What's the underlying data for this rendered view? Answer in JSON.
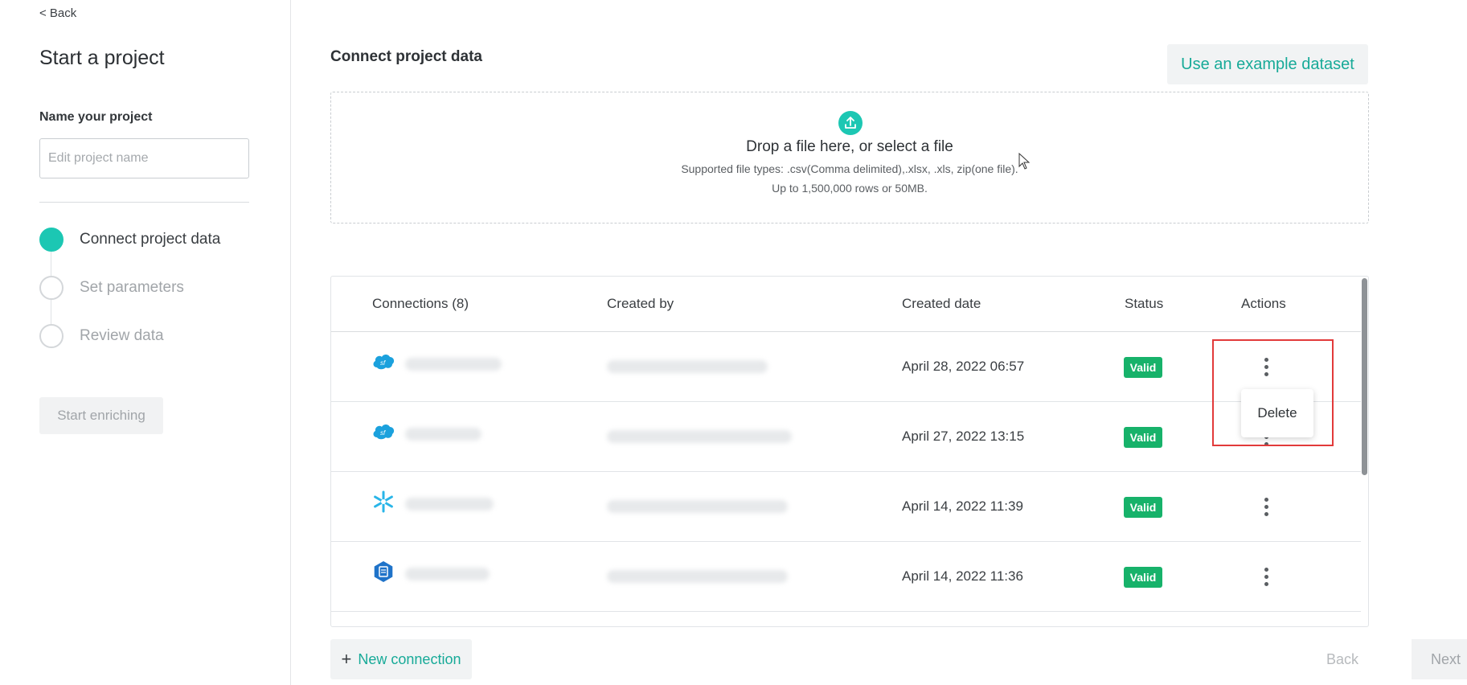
{
  "sidebar": {
    "back_label": "< Back",
    "title": "Start a project",
    "name_label": "Name your project",
    "name_placeholder": "Edit project name",
    "name_value": "",
    "steps": [
      {
        "label": "Connect project data",
        "active": true
      },
      {
        "label": "Set parameters",
        "active": false
      },
      {
        "label": "Review data",
        "active": false
      }
    ],
    "start_button": "Start enriching"
  },
  "main": {
    "section_title": "Connect project data",
    "example_button": "Use an example dataset",
    "dropzone": {
      "title": "Drop a file here, or select a file",
      "supported": "Supported file types: .csv(Comma delimited),.xlsx, .xls, zip(one file).",
      "limit": "Up to 1,500,000 rows or 50MB."
    },
    "table": {
      "headers": {
        "connections": "Connections (8)",
        "created_by": "Created by",
        "created_date": "Created date",
        "status": "Status",
        "actions": "Actions"
      },
      "rows": [
        {
          "icon": "salesforce-icon",
          "created_date": "April 28, 2022 06:57",
          "status": "Valid"
        },
        {
          "icon": "salesforce-icon",
          "created_date": "April 27, 2022 13:15",
          "status": "Valid"
        },
        {
          "icon": "snowflake-icon",
          "created_date": "April 14, 2022 11:39",
          "status": "Valid"
        },
        {
          "icon": "azure-blob-icon",
          "created_date": "April 14, 2022 11:36",
          "status": "Valid"
        }
      ]
    },
    "actions_menu": {
      "delete_label": "Delete"
    },
    "new_connection": "New connection",
    "footer": {
      "back": "Back",
      "next": "Next"
    }
  },
  "colors": {
    "accent": "#1cc7b3",
    "accent_text": "#17aa98",
    "valid_badge": "#17b26a",
    "highlight": "#e23a3a"
  }
}
